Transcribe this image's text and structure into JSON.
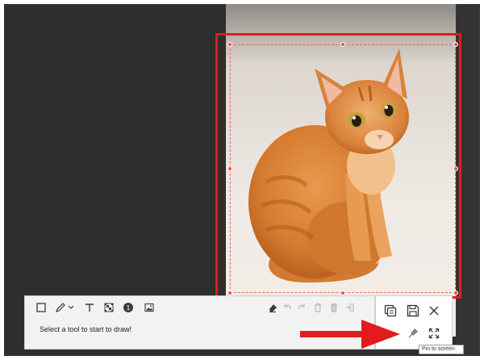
{
  "toolbar": {
    "tools": [
      {
        "name": "rectangle-tool"
      },
      {
        "name": "pen-tool"
      },
      {
        "name": "text-tool"
      },
      {
        "name": "mosaic-tool"
      },
      {
        "name": "step-number-tool",
        "label": "1"
      },
      {
        "name": "image-tool"
      }
    ],
    "hint": "Select a tool to start to draw!"
  },
  "tooltip": {
    "text": "Pin to screen"
  },
  "colors": {
    "annotation_red": "#e31b1b",
    "selection_handle": "#e2584a",
    "background": "#2e2e2e"
  }
}
